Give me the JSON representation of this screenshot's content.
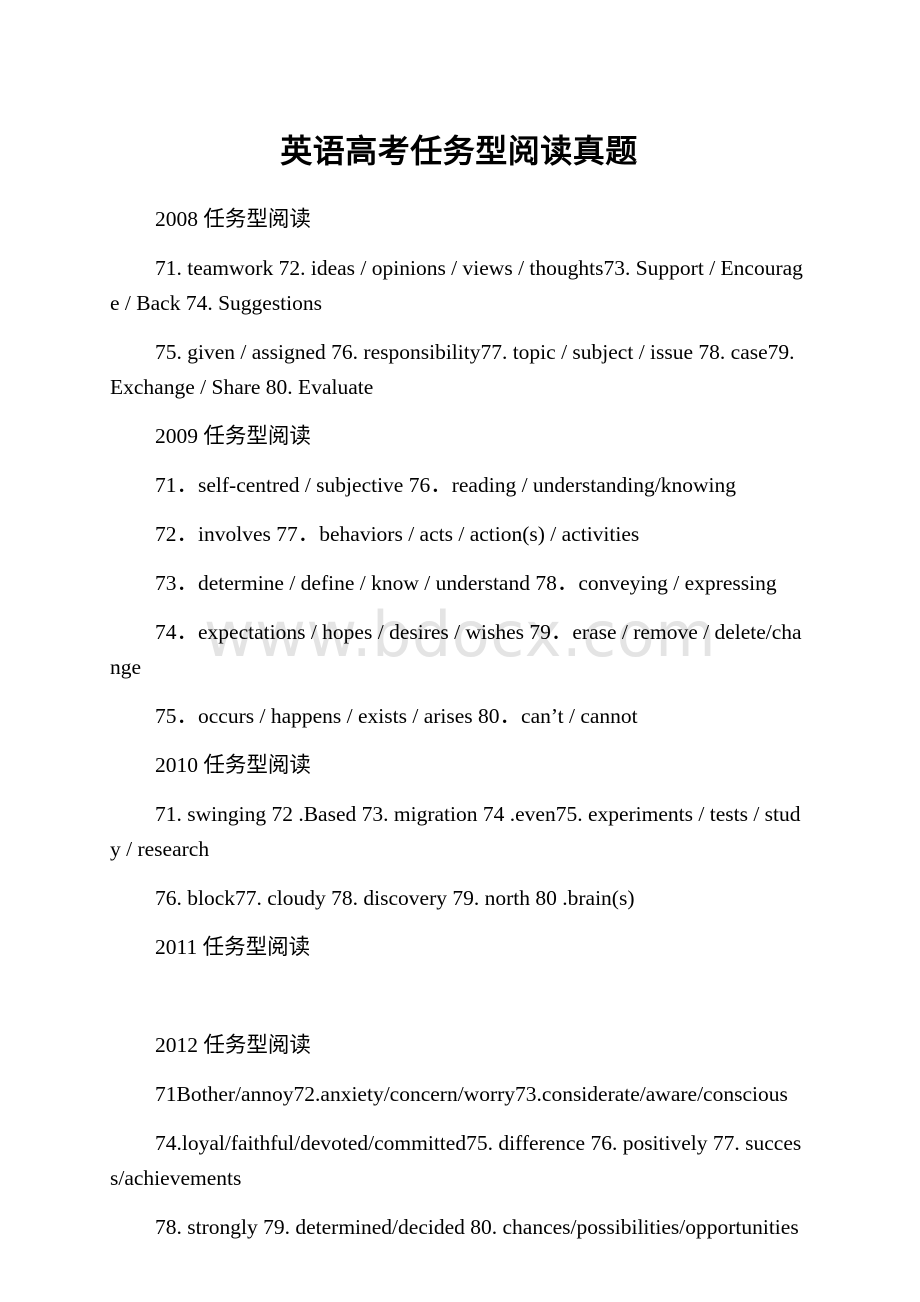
{
  "document": {
    "title": "英语高考任务型阅读真题",
    "watermark": "www.bdocx.com",
    "watermark_color": "#e4e4e4",
    "text_color": "#000000",
    "background_color": "#ffffff"
  },
  "sections": [
    {
      "heading": "2008 任务型阅读",
      "paragraphs": [
        "71. teamwork 72. ideas / opinions / views / thoughts73. Support / Encourage / Back 74. Suggestions",
        "75. given / assigned 76. responsibility77. topic / subject / issue 78. case79. Exchange / Share 80. Evaluate"
      ]
    },
    {
      "heading": "2009 任务型阅读",
      "paragraphs": [
        "71．self-centred / subjective 76．reading / understanding/knowing",
        "72．involves 77．behaviors / acts / action(s) / activities",
        "73．determine / define / know / understand 78．conveying / expressing",
        "74．expectations / hopes / desires / wishes 79．erase / remove / delete/change",
        "75．occurs / happens / exists / arises 80．can’t / cannot"
      ]
    },
    {
      "heading": "2010 任务型阅读",
      "paragraphs": [
        "71. swinging 72 .Based 73. migration 74 .even75. experiments / tests / study / research",
        "76. block77. cloudy 78. discovery 79. north 80 .brain(s)"
      ]
    },
    {
      "heading": "2011 任务型阅读",
      "paragraphs": [
        ""
      ]
    },
    {
      "heading": "2012 任务型阅读",
      "paragraphs": [
        "71Bother/annoy72.anxiety/concern/worry73.considerate/aware/conscious",
        "74.loyal/faithful/devoted/committed75. difference 76. positively 77. success/achievements",
        "78. strongly 79. determined/decided 80. chances/possibilities/opportunities"
      ]
    }
  ]
}
